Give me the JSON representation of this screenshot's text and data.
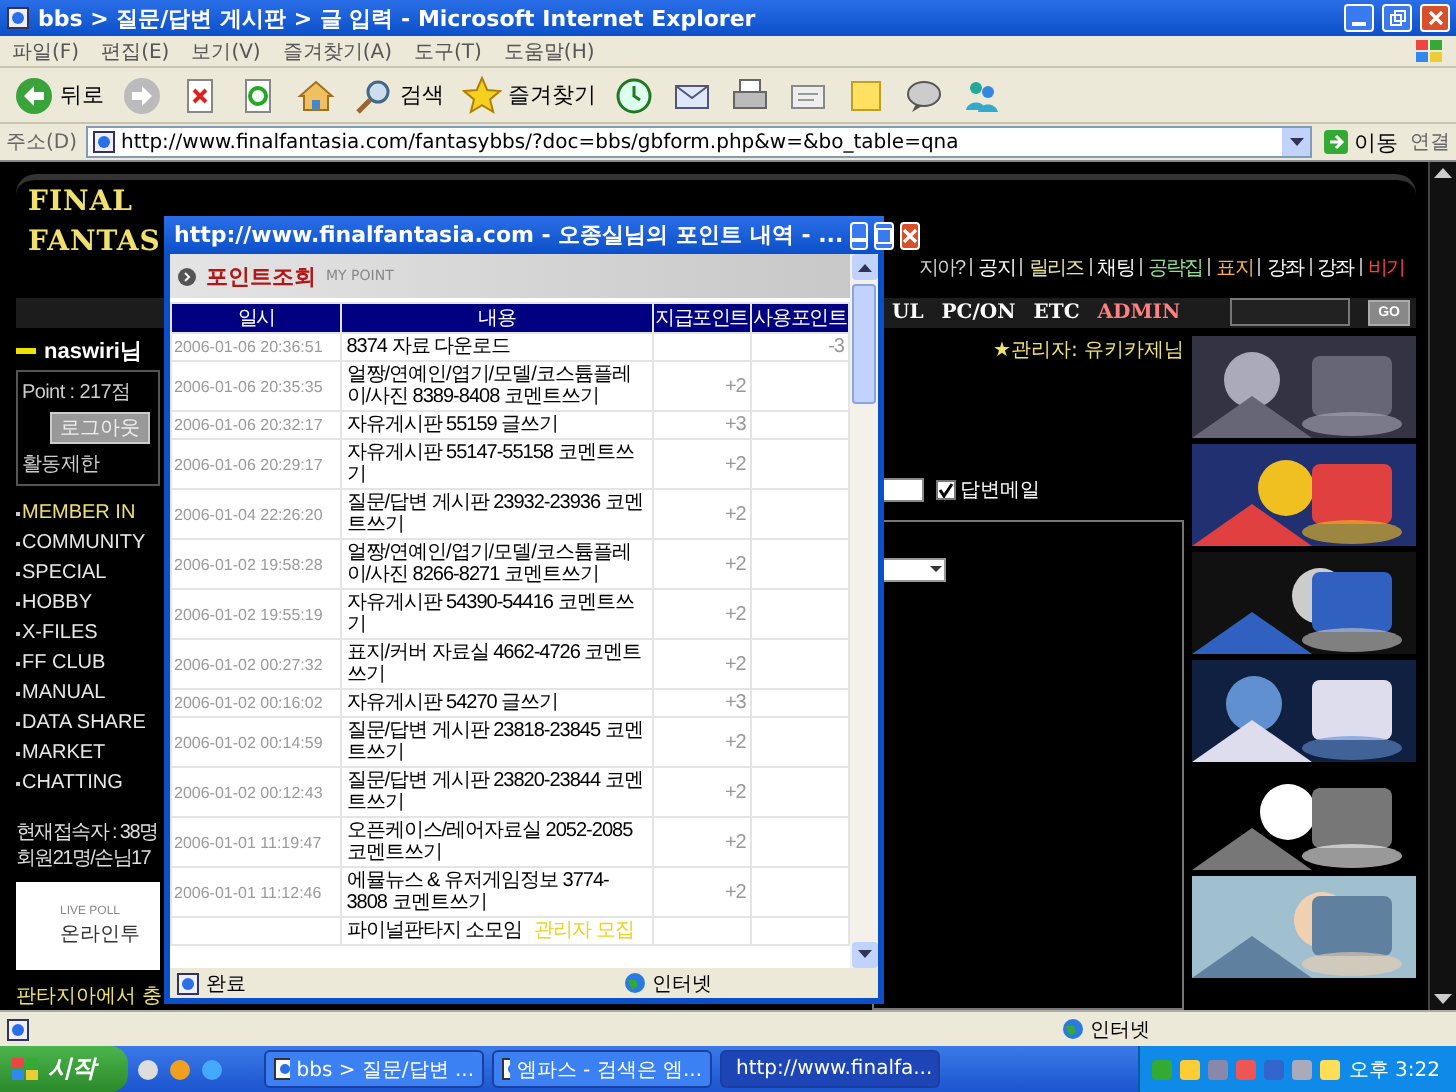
{
  "window": {
    "title": "bbs > 질문/답변 게시판 > 글 입력 - Microsoft Internet Explorer"
  },
  "menu": [
    "파일(F)",
    "편집(E)",
    "보기(V)",
    "즐겨찾기(A)",
    "도구(T)",
    "도움말(H)"
  ],
  "toolbar": [
    {
      "kind": "back",
      "label": "뒤로"
    },
    {
      "kind": "forward"
    },
    {
      "kind": "stop"
    },
    {
      "kind": "refresh"
    },
    {
      "kind": "home"
    },
    {
      "kind": "search",
      "label": "검색"
    },
    {
      "kind": "favorites",
      "label": "즐겨찾기"
    },
    {
      "kind": "history"
    },
    {
      "kind": "mail"
    },
    {
      "kind": "print"
    },
    {
      "kind": "edit"
    },
    {
      "kind": "note"
    },
    {
      "kind": "messenger"
    },
    {
      "kind": "contacts"
    }
  ],
  "address": {
    "label": "주소(D)",
    "url": "http://www.finalfantasia.com/fantasybbs/?doc=bbs/gbform.php&w=&bo_table=qna",
    "go": "이동",
    "links": "연결"
  },
  "site": {
    "logo": [
      "FINAL",
      "FANTAS"
    ],
    "nav": [
      {
        "label": "지아?",
        "color": "#d0d0d0"
      },
      {
        "label": "공지",
        "color": "#ffffff"
      },
      {
        "label": "릴리즈",
        "color": "#e8e0a0"
      },
      {
        "label": "채팅",
        "color": "#ffffff"
      },
      {
        "label": "공략집",
        "color": "#8ee08e"
      },
      {
        "label": "표지",
        "color": "#ffb050"
      },
      {
        "label": "강좌",
        "color": "#ffffff"
      },
      {
        "label": "강좌",
        "color": "#ffffff"
      },
      {
        "label": "비기",
        "color": "#ff4040"
      }
    ],
    "menu": [
      {
        "label": "UL",
        "color": "#ffffff"
      },
      {
        "label": "PC/ON",
        "color": "#ffffff"
      },
      {
        "label": "ETC",
        "color": "#ffffff"
      },
      {
        "label": "ADMIN",
        "color": "#ff8080"
      }
    ],
    "search_button": "GO",
    "admin": "★관리자: 유키카제님",
    "user": {
      "name": "naswiri님",
      "point": "Point : 217점",
      "logout": "로그아웃",
      "restrict": "활동제한"
    },
    "categories": [
      {
        "label": "MEMBER IN",
        "selected": true
      },
      {
        "label": "COMMUNITY",
        "selected": false
      },
      {
        "label": "SPECIAL",
        "selected": false
      },
      {
        "label": "HOBBY",
        "selected": false
      },
      {
        "label": "X-FILES",
        "selected": false
      },
      {
        "label": "FF CLUB",
        "selected": false
      },
      {
        "label": "MANUAL",
        "selected": false
      },
      {
        "label": "DATA SHARE",
        "selected": false
      },
      {
        "label": "MARKET",
        "selected": false
      },
      {
        "label": "CHATTING",
        "selected": false
      }
    ],
    "online": [
      "현재접속자 : 38명",
      "회원21명/손님17"
    ],
    "poll": {
      "label": "LIVE POLL",
      "title": "온라인투"
    },
    "notice": "판타지아에서 충",
    "reply_mail": {
      "label": "답변메일",
      "checked": true
    },
    "banners": [
      {
        "kind": "picture"
      },
      {
        "kind": "picture"
      },
      {
        "kind": "picture"
      },
      {
        "kind": "picture"
      },
      {
        "kind": "picture"
      },
      {
        "kind": "picture"
      }
    ]
  },
  "popup": {
    "title": "http://www.finalfantasia.com - 오종실님의 포인트 내역 - ...",
    "heading": "포인트조회",
    "subheading": "MY POINT",
    "columns": [
      "일시",
      "내용",
      "지급포인트",
      "사용포인트"
    ],
    "rows": [
      {
        "date": "2006-01-06 20:36:51",
        "content": "8374 자료 다운로드",
        "used": "-3"
      },
      {
        "date": "2006-01-06 20:35:35",
        "content": "얼짱/연예인/엽기/모델/코스튬플레이/사진 8389-8408 코멘트쓰기",
        "earned": "+2"
      },
      {
        "date": "2006-01-06 20:32:17",
        "content": "자유게시판 55159 글쓰기",
        "earned": "+3"
      },
      {
        "date": "2006-01-06 20:29:17",
        "content": "자유게시판 55147-55158 코멘트쓰기",
        "earned": "+2"
      },
      {
        "date": "2006-01-04 22:26:20",
        "content": "질문/답변 게시판 23932-23936 코멘트쓰기",
        "earned": "+2"
      },
      {
        "date": "2006-01-02 19:58:28",
        "content": "얼짱/연예인/엽기/모델/코스튬플레이/사진 8266-8271 코멘트쓰기",
        "earned": "+2"
      },
      {
        "date": "2006-01-02 19:55:19",
        "content": "자유게시판 54390-54416 코멘트쓰기",
        "earned": "+2"
      },
      {
        "date": "2006-01-02 00:27:32",
        "content": "표지/커버 자료실 4662-4726 코멘트쓰기",
        "earned": "+2"
      },
      {
        "date": "2006-01-02 00:16:02",
        "content": "자유게시판 54270 글쓰기",
        "earned": "+3"
      },
      {
        "date": "2006-01-02 00:14:59",
        "content": "질문/답변 게시판 23818-23845 코멘트쓰기",
        "earned": "+2"
      },
      {
        "date": "2006-01-02 00:12:43",
        "content": "질문/답변 게시판 23820-23844 코멘트쓰기",
        "earned": "+2"
      },
      {
        "date": "2006-01-01 11:19:47",
        "content": "오픈케이스/레어자료실 2052-2085 코멘트쓰기",
        "earned": "+2"
      },
      {
        "date": "2006-01-01 11:12:46",
        "content": "에뮬뉴스 & 유저게임정보 3774-3808 코멘트쓰기",
        "earned": "+2"
      },
      {
        "content": "파이널판타지 소모임",
        "tag": "관리자 모집"
      }
    ],
    "status": "완료",
    "zone": "인터넷"
  },
  "status_bar": {
    "zone": "인터넷"
  },
  "taskbar": {
    "start": "시작",
    "tasks": [
      {
        "label": "bbs > 질문/답변 ...",
        "selected": false
      },
      {
        "label": "엠파스 - 검색은 엠...",
        "selected": false
      },
      {
        "label": "http://www.finalfa...",
        "selected": true
      }
    ],
    "clock": "오후 3:22"
  }
}
